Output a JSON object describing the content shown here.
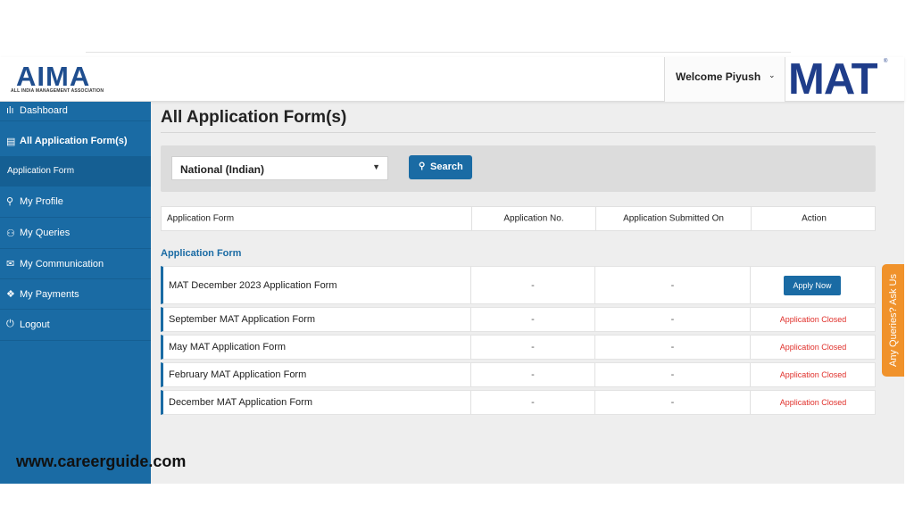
{
  "header": {
    "aima_logo_text": "AIMA",
    "aima_logo_subtitle": "ALL INDIA MANAGEMENT ASSOCIATION",
    "welcome_text": "Welcome Piyush",
    "mat_logo_text": "MAT",
    "mat_logo_mark": "®"
  },
  "sidebar": {
    "items": [
      {
        "label": "Dashboard",
        "icon": "bar-chart-icon",
        "glyph": "ılı"
      },
      {
        "label": "All Application Form(s)",
        "icon": "document-icon",
        "glyph": "▤"
      },
      {
        "label": "Application Form",
        "icon": "",
        "glyph": ""
      },
      {
        "label": "My Profile",
        "icon": "user-icon",
        "glyph": "⚲"
      },
      {
        "label": "My Queries",
        "icon": "chat-icon",
        "glyph": "⚇"
      },
      {
        "label": "My Communication",
        "icon": "envelope-icon",
        "glyph": "✉"
      },
      {
        "label": "My Payments",
        "icon": "tag-icon",
        "glyph": "❖"
      },
      {
        "label": "Logout",
        "icon": "power-icon",
        "glyph": "⏻"
      }
    ]
  },
  "main": {
    "title": "All Application Form(s)",
    "filter": {
      "selected": "National (Indian)",
      "search_label": "Search",
      "search_icon_glyph": "🔍"
    },
    "table": {
      "headers": [
        "Application Form",
        "Application No.",
        "Application Submitted On",
        "Action"
      ],
      "section_label": "Application Form",
      "rows": [
        {
          "name": "MAT December 2023 Application Form",
          "app_no": "-",
          "submitted_on": "-",
          "action": "Apply Now",
          "action_type": "button"
        },
        {
          "name": "September MAT Application Form",
          "app_no": "-",
          "submitted_on": "-",
          "action": "Application Closed",
          "action_type": "closed"
        },
        {
          "name": "May MAT Application Form",
          "app_no": "-",
          "submitted_on": "-",
          "action": "Application Closed",
          "action_type": "closed"
        },
        {
          "name": "February MAT Application Form",
          "app_no": "-",
          "submitted_on": "-",
          "action": "Application Closed",
          "action_type": "closed"
        },
        {
          "name": "December MAT Application Form",
          "app_no": "-",
          "submitted_on": "-",
          "action": "Application Closed",
          "action_type": "closed"
        }
      ]
    }
  },
  "queries_tab": "Any Queries? Ask Us",
  "watermark": "www.careerguide.com",
  "colors": {
    "brand_blue": "#1a6ba4",
    "closed_red": "#e0302b",
    "queries_orange": "#f0922b",
    "mat_logo_blue": "#1f3d8a"
  }
}
